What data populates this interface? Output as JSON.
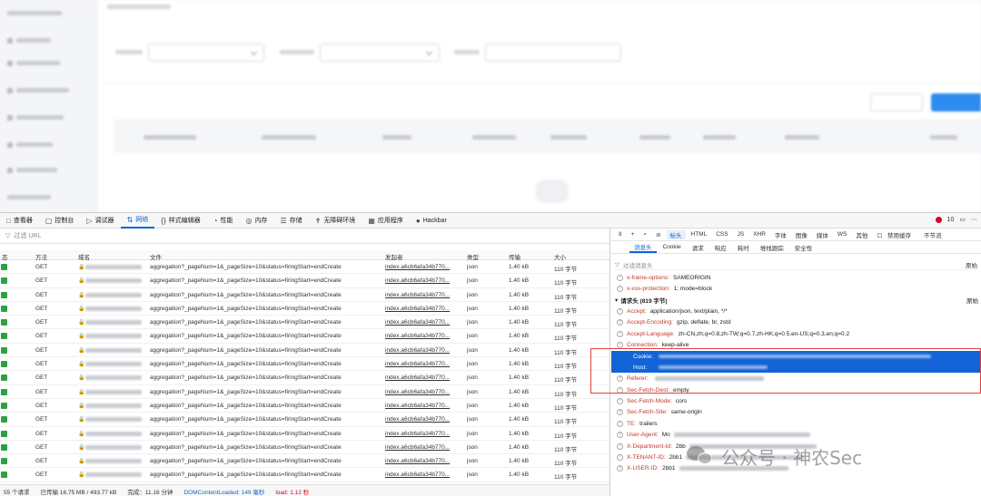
{
  "devtools": {
    "tabs": [
      {
        "icon": "□",
        "label": "查看器",
        "name": "tab-inspector"
      },
      {
        "icon": "▢",
        "label": "控制台",
        "name": "tab-console"
      },
      {
        "icon": "▷",
        "label": "调试器",
        "name": "tab-debugger"
      },
      {
        "icon": "⇅",
        "label": "网络",
        "name": "tab-network",
        "active": true
      },
      {
        "icon": "{}",
        "label": "样式编辑器",
        "name": "tab-style-editor"
      },
      {
        "icon": "◔",
        "label": "性能",
        "name": "tab-performance"
      },
      {
        "icon": "◎",
        "label": "内存",
        "name": "tab-memory"
      },
      {
        "icon": "☰",
        "label": "存储",
        "name": "tab-storage"
      },
      {
        "icon": "✝",
        "label": "无障碍环境",
        "name": "tab-accessibility"
      },
      {
        "icon": "▦",
        "label": "应用程序",
        "name": "tab-application"
      },
      {
        "icon": "●",
        "label": "Hackbar",
        "name": "tab-hackbar"
      }
    ],
    "error_count": "10"
  },
  "network": {
    "filter_placeholder": "过滤 URL",
    "columns": {
      "status": "态",
      "method": "方法",
      "domain": "域名",
      "file": "文件",
      "initiator": "发起者",
      "type": "类型",
      "transferred": "传输",
      "size": "大小"
    },
    "rows": [
      {
        "method": "GET",
        "file": "aggregation?_pageNum=1&_pageSize=10&status=firingStart=endCreate",
        "initiator": "index.a6cb6afa34b770...",
        "type": "json",
        "transferred": "1.40 kB",
        "size": "110 字节"
      },
      {
        "method": "GET",
        "file": "aggregation?_pageNum=1&_pageSize=10&status=firingStart=endCreate",
        "initiator": "index.a6cb6afa34b770...",
        "type": "json",
        "transferred": "1.40 kB",
        "size": "110 字节"
      },
      {
        "method": "GET",
        "file": "aggregation?_pageNum=1&_pageSize=10&status=firingStart=endCreate",
        "initiator": "index.a6cb6afa34b770...",
        "type": "json",
        "transferred": "1.40 kB",
        "size": "110 字节"
      },
      {
        "method": "GET",
        "file": "aggregation?_pageNum=1&_pageSize=10&status=firingStart=endCreate",
        "initiator": "index.a6cb6afa34b770...",
        "type": "json",
        "transferred": "1.40 kB",
        "size": "110 字节"
      },
      {
        "method": "GET",
        "file": "aggregation?_pageNum=1&_pageSize=10&status=firingStart=endCreate",
        "initiator": "index.a6cb6afa34b770...",
        "type": "json",
        "transferred": "1.40 kB",
        "size": "110 字节"
      },
      {
        "method": "GET",
        "file": "aggregation?_pageNum=1&_pageSize=10&status=firingStart=endCreate",
        "initiator": "index.a6cb6afa34b770...",
        "type": "json",
        "transferred": "1.40 kB",
        "size": "110 字节"
      },
      {
        "method": "GET",
        "file": "aggregation?_pageNum=1&_pageSize=10&status=firingStart=endCreate",
        "initiator": "index.a6cb6afa34b770...",
        "type": "json",
        "transferred": "1.40 kB",
        "size": "110 字节"
      },
      {
        "method": "GET",
        "file": "aggregation?_pageNum=1&_pageSize=10&status=firingStart=endCreate",
        "initiator": "index.a6cb6afa34b770...",
        "type": "json",
        "transferred": "1.40 kB",
        "size": "110 字节"
      },
      {
        "method": "GET",
        "file": "aggregation?_pageNum=1&_pageSize=10&status=firingStart=endCreate",
        "initiator": "index.a6cb6afa34b770...",
        "type": "json",
        "transferred": "1.40 kB",
        "size": "110 字节"
      },
      {
        "method": "GET",
        "file": "aggregation?_pageNum=1&_pageSize=10&status=firingStart=endCreate",
        "initiator": "index.a6cb6afa34b770...",
        "type": "json",
        "transferred": "1.40 kB",
        "size": "110 字节"
      },
      {
        "method": "GET",
        "file": "aggregation?_pageNum=1&_pageSize=10&status=firingStart=endCreate",
        "initiator": "index.a6cb6afa34b770...",
        "type": "json",
        "transferred": "1.40 kB",
        "size": "110 字节"
      },
      {
        "method": "GET",
        "file": "aggregation?_pageNum=1&_pageSize=10&status=firingStart=endCreate",
        "initiator": "index.a6cb6afa34b770...",
        "type": "json",
        "transferred": "1.40 kB",
        "size": "110 字节"
      },
      {
        "method": "GET",
        "file": "aggregation?_pageNum=1&_pageSize=10&status=firingStart=endCreate",
        "initiator": "index.a6cb6afa34b770...",
        "type": "json",
        "transferred": "1.40 kB",
        "size": "110 字节"
      },
      {
        "method": "GET",
        "file": "aggregation?_pageNum=1&_pageSize=10&status=firingStart=endCreate",
        "initiator": "index.a6cb6afa34b770...",
        "type": "json",
        "transferred": "1.40 kB",
        "size": "110 字节"
      },
      {
        "method": "GET",
        "file": "aggregation?_pageNum=1&_pageSize=10&status=firingStart=endCreate",
        "initiator": "index.a6cb6afa34b770...",
        "type": "json",
        "transferred": "1.40 kB",
        "size": "110 字节"
      },
      {
        "method": "GET",
        "file": "aggregation?_pageNum=1&_pageSize=10&status=firingStart=endCreate",
        "initiator": "index.a6cb6afa34b770...",
        "type": "json",
        "transferred": "1.40 kB",
        "size": "110 字节"
      }
    ],
    "footer": {
      "requests": "55 个请求",
      "transferred": "已传输 16.75 MB / 493.77 kB",
      "finish": "完成：11.16 分钟",
      "dcl": "DOMContentLoaded: 149 毫秒",
      "load": "load: 1.12 秒"
    }
  },
  "details": {
    "tabs": [
      "标头",
      "HTML",
      "CSS",
      "JS",
      "XHR",
      "字体",
      "图像",
      "媒体",
      "WS",
      "其他"
    ],
    "disable_cache": "禁用缓存",
    "throttle": "不节流",
    "sub_tabs": [
      "消息头",
      "Cookie",
      "请求",
      "响应",
      "耗时",
      "堆栈跟踪",
      "安全性"
    ],
    "filter_placeholder": "过滤消息头",
    "raw_label": "原始",
    "response_headers": [
      {
        "key": "x-frame-options:",
        "value": "SAMEORIGIN"
      },
      {
        "key": "x-xss-protection:",
        "value": "1; mode=block"
      }
    ],
    "request_section": "请求头 (819 字节)",
    "request_headers": [
      {
        "key": "Accept:",
        "value": "application/json, text/plain, */*"
      },
      {
        "key": "Accept-Encoding:",
        "value": "gzip, deflate, br, zstd"
      },
      {
        "key": "Accept-Language:",
        "value": "zh-CN,zh;q=0.8,zh-TW;q=0.7,zh-HK;q=0.5,en-US;q=0.3,en;q=0.2"
      },
      {
        "key": "Connection:",
        "value": "keep-alive"
      }
    ],
    "highlighted": [
      "Cookie:",
      "Host:"
    ],
    "more_headers": [
      {
        "key": "Referer:",
        "value": ""
      },
      {
        "key": "Sec-Fetch-Dest:",
        "value": "empty"
      },
      {
        "key": "Sec-Fetch-Mode:",
        "value": "cors"
      },
      {
        "key": "Sec-Fetch-Site:",
        "value": "same-origin"
      },
      {
        "key": "TE:",
        "value": "trailers"
      },
      {
        "key": "User-Agent:",
        "value": "Mo"
      },
      {
        "key": "X-Department-Id:",
        "value": "2bb"
      },
      {
        "key": "X-TENANT-ID:",
        "value": "2bb1"
      },
      {
        "key": "X-USER-ID:",
        "value": "2bb1"
      }
    ]
  },
  "watermark": "公众号 · 神农Sec"
}
